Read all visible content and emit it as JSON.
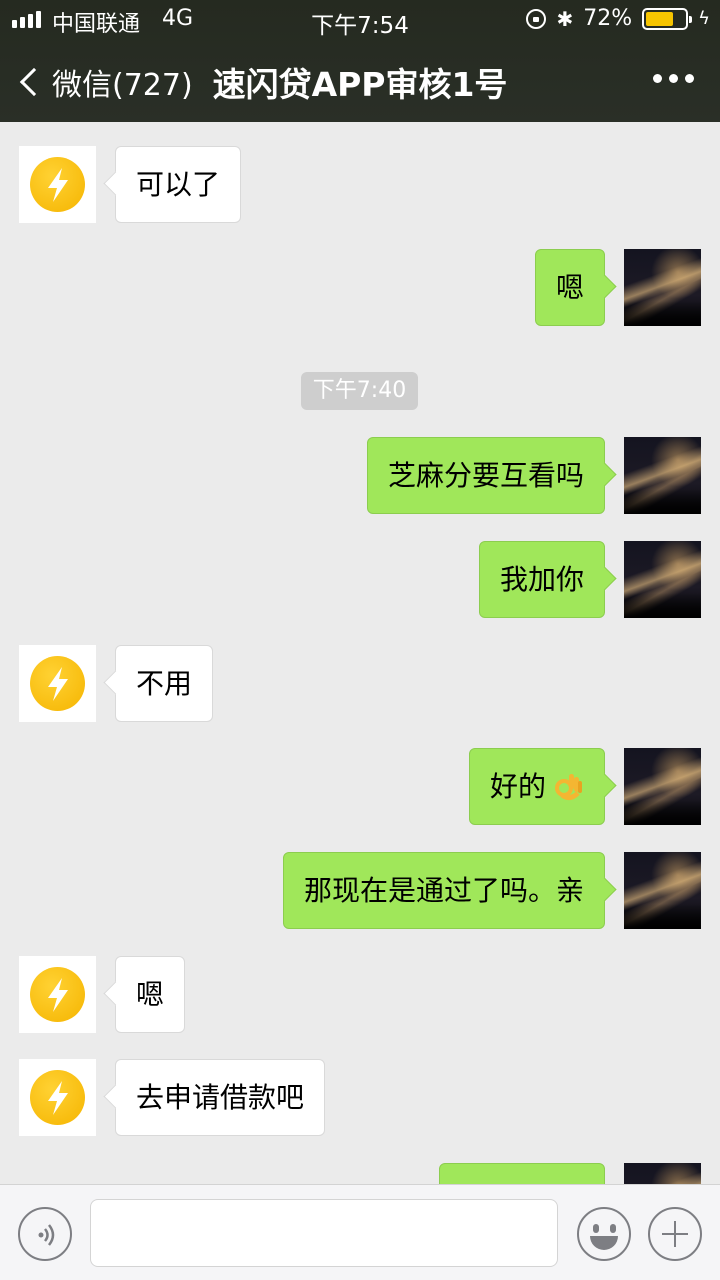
{
  "status_bar": {
    "carrier": "中国联通",
    "network": "4G",
    "time": "下午7:54",
    "battery": "72%",
    "battery_level": 0.72
  },
  "nav": {
    "back_label": "微信(727)",
    "title": "速闪贷APP审核1号"
  },
  "chat": {
    "timestamp": "下午7:40",
    "messages": [
      {
        "from": "contact",
        "text": "可以了"
      },
      {
        "from": "me",
        "text": "嗯"
      },
      {
        "from": "me",
        "text": "芝麻分要互看吗"
      },
      {
        "from": "me",
        "text": "我加你"
      },
      {
        "from": "contact",
        "text": "不用"
      },
      {
        "from": "me",
        "text": "好的",
        "emoji": "ok-hand"
      },
      {
        "from": "me",
        "text": "那现在是通过了吗。亲"
      },
      {
        "from": "contact",
        "text": "嗯"
      },
      {
        "from": "contact",
        "text": "去申请借款吧"
      },
      {
        "from": "me",
        "text": ""
      }
    ]
  },
  "input": {
    "placeholder": ""
  },
  "colors": {
    "nav_bg": "#2a2f27",
    "outgoing_bubble": "#a0e75a",
    "incoming_bubble": "#ffffff",
    "chat_bg": "#ebebeb",
    "app_logo": "#f5b400"
  },
  "icons": {
    "back": "chevron-left-icon",
    "more": "more-dots-icon",
    "voice": "voice-icon",
    "emoji": "emoji-icon",
    "plus": "plus-icon",
    "contact_avatar": "lightning-bolt-icon"
  }
}
